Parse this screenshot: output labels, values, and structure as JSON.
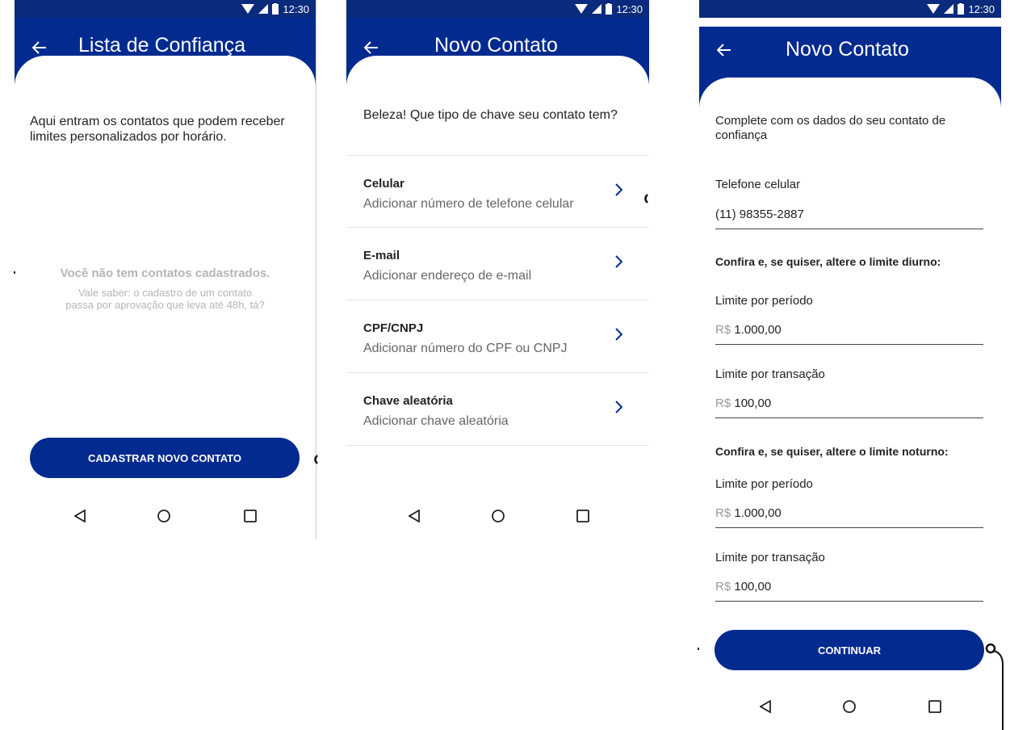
{
  "status": {
    "time": "12:30"
  },
  "screen1": {
    "title": "Lista de Confiança",
    "intro": "Aqui entram os contatos que podem receber limites personalizados por horário.",
    "empty_title": "Você não tem contatos cadastrados.",
    "empty_line1": "Vale saber: o cadastro de um contato",
    "empty_line2": "passa por aprovação que leva até 48h, tá?",
    "cta": "CADASTRAR NOVO CONTATO"
  },
  "screen2": {
    "title": "Novo Contato",
    "intro": "Beleza! Que tipo de chave seu contato tem?",
    "items": [
      {
        "title": "Celular",
        "subtitle": "Adicionar número de telefone celular"
      },
      {
        "title": "E-mail",
        "subtitle": "Adicionar endereço de e-mail"
      },
      {
        "title": "CPF/CNPJ",
        "subtitle": "Adicionar número do CPF ou CNPJ"
      },
      {
        "title": "Chave aleatória",
        "subtitle": "Adicionar chave aleatória"
      }
    ]
  },
  "screen3": {
    "title": "Novo Contato",
    "intro_line1": "Complete com os dados do seu contato de",
    "intro_line2": "confiança",
    "phone_label": "Telefone celular",
    "phone_value": "(11) 98355-2887",
    "day_heading": "Confira e, se quiser, altere o limite diurno:",
    "night_heading": "Confira e, se quiser, altere o limite noturno:",
    "period_label": "Limite por período",
    "transaction_label": "Limite por transação",
    "currency": "R$",
    "day_period_value": "1.000,00",
    "day_transaction_value": "100,00",
    "night_period_value": "1.000,00",
    "night_transaction_value": "100,00",
    "cta": "CONTINUAR"
  },
  "colors": {
    "primary": "#032a8f",
    "statusbar": "#0a2a7c"
  },
  "icons": [
    "wifi-icon",
    "signal-icon",
    "battery-icon",
    "back-arrow-icon",
    "chevron-right-icon",
    "nav-back-icon",
    "nav-home-icon",
    "nav-recents-icon"
  ]
}
